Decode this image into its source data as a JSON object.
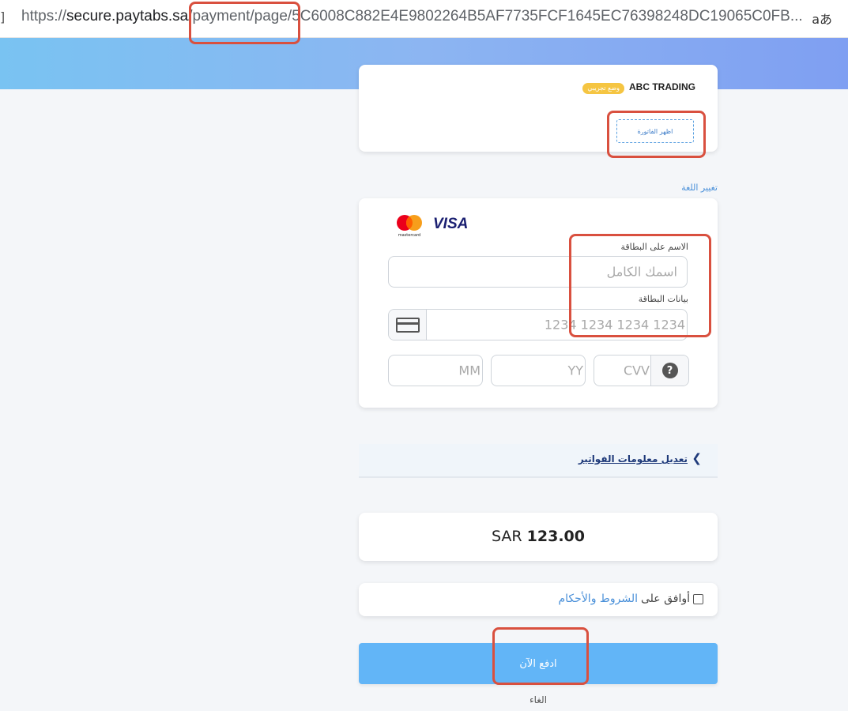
{
  "browser": {
    "left_glyph": "]",
    "url_scheme": "https://",
    "url_host": "secure.paytabs.sa",
    "url_path": "/payment/page/5C6008C882E4E9802264B5AF7735FCF1645EC76398248DC19065C0FB...",
    "translate_icon": "aあ"
  },
  "merchant": {
    "name": "ABC TRADING",
    "badge": "وضع تجريبي",
    "invoice_button": "اظهر الفاتورة"
  },
  "language_link": "تغيير اللغة",
  "payment": {
    "brand_mastercard": "mastercard",
    "brand_visa": "VISA",
    "name_label": "الاسم على البطاقة",
    "name_placeholder": "اسمك الكامل",
    "card_label": "بيانات البطاقة",
    "card_placeholder": "1234 1234 1234 1234",
    "mm_placeholder": "MM",
    "yy_placeholder": "YY",
    "cvv_placeholder": "CVV",
    "help_icon": "?"
  },
  "billing": {
    "link": "تعديل معلومات الفواتير",
    "chevron": "❮"
  },
  "amount": {
    "currency": "SAR",
    "value": "123.00"
  },
  "terms": {
    "prefix": "أوافق على",
    "link": "الشروط والأحكام"
  },
  "pay_button": "ادفع الآن",
  "cancel": "الغاء",
  "colors": {
    "accent": "#62b5f7",
    "highlight": "#d9503f",
    "badge": "#f5c542"
  }
}
